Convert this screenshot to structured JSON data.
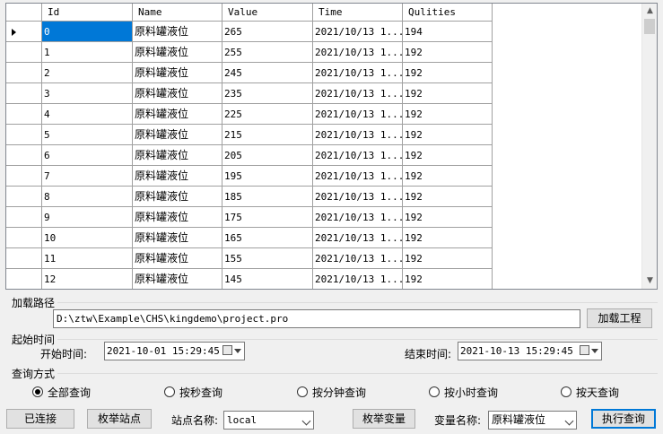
{
  "grid": {
    "columns": [
      "Id",
      "Name",
      "Value",
      "Time",
      "Qulities"
    ],
    "rows": [
      {
        "id": "0",
        "name": "原料罐液位",
        "value": "265",
        "time": "2021/10/13 1...",
        "quality": "194"
      },
      {
        "id": "1",
        "name": "原料罐液位",
        "value": "255",
        "time": "2021/10/13 1...",
        "quality": "192"
      },
      {
        "id": "2",
        "name": "原料罐液位",
        "value": "245",
        "time": "2021/10/13 1...",
        "quality": "192"
      },
      {
        "id": "3",
        "name": "原料罐液位",
        "value": "235",
        "time": "2021/10/13 1...",
        "quality": "192"
      },
      {
        "id": "4",
        "name": "原料罐液位",
        "value": "225",
        "time": "2021/10/13 1...",
        "quality": "192"
      },
      {
        "id": "5",
        "name": "原料罐液位",
        "value": "215",
        "time": "2021/10/13 1...",
        "quality": "192"
      },
      {
        "id": "6",
        "name": "原料罐液位",
        "value": "205",
        "time": "2021/10/13 1...",
        "quality": "192"
      },
      {
        "id": "7",
        "name": "原料罐液位",
        "value": "195",
        "time": "2021/10/13 1...",
        "quality": "192"
      },
      {
        "id": "8",
        "name": "原料罐液位",
        "value": "185",
        "time": "2021/10/13 1...",
        "quality": "192"
      },
      {
        "id": "9",
        "name": "原料罐液位",
        "value": "175",
        "time": "2021/10/13 1...",
        "quality": "192"
      },
      {
        "id": "10",
        "name": "原料罐液位",
        "value": "165",
        "time": "2021/10/13 1...",
        "quality": "192"
      },
      {
        "id": "11",
        "name": "原料罐液位",
        "value": "155",
        "time": "2021/10/13 1...",
        "quality": "192"
      },
      {
        "id": "12",
        "name": "原料罐液位",
        "value": "145",
        "time": "2021/10/13 1...",
        "quality": "192"
      }
    ]
  },
  "load_path": {
    "group_label": "加载路径",
    "path_value": "D:\\ztw\\Example\\CHS\\kingdemo\\project.pro",
    "load_button": "加载工程"
  },
  "time_range": {
    "group_label": "起始时间",
    "start_label": "开始时间:",
    "start_value": "2021-10-01 15:29:45",
    "end_label": "结束时间:",
    "end_value": "2021-10-13 15:29:45"
  },
  "query_mode": {
    "group_label": "查询方式",
    "options": [
      "全部查询",
      "按秒查询",
      "按分钟查询",
      "按小时查询",
      "按天查询"
    ],
    "selected": 0
  },
  "bottom": {
    "connected_button": "已连接",
    "enum_sites_button": "枚举站点",
    "site_label": "站点名称:",
    "site_value": "local",
    "enum_vars_button": "枚举变量",
    "var_label": "变量名称:",
    "var_value": "原料罐液位",
    "execute_button": "执行查询"
  }
}
